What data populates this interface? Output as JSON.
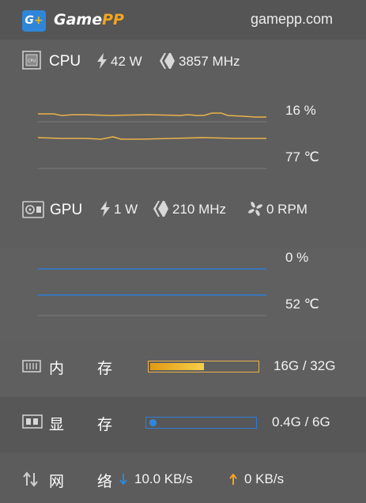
{
  "header": {
    "logo_letter": "G",
    "logo_plus": "+",
    "brand_main": "Game",
    "brand_pp": "PP",
    "site": "gamepp.com"
  },
  "cpu": {
    "label": "CPU",
    "power": "42 W",
    "clock": "3857 MHz",
    "usage": "16 %",
    "temp": "77 ℃",
    "icon_text": "CPU"
  },
  "gpu": {
    "label": "GPU",
    "power": "1 W",
    "clock": "210 MHz",
    "fan": "0 RPM",
    "usage": "0 %",
    "temp": "52 ℃"
  },
  "memory": {
    "label": "内 存",
    "value": "16G / 32G",
    "fill_fraction": 0.5
  },
  "vram": {
    "label": "显 存",
    "value": "0.4G / 6G",
    "fill_fraction": 0.067
  },
  "network": {
    "label": "网 络",
    "download": "10.0 KB/s",
    "upload": "0 KB/s"
  },
  "colors": {
    "accent_orange": "#f3b31f",
    "accent_blue": "#2f86d8",
    "line_orange": "#e9b24a",
    "line_blue": "#2e7cd6"
  },
  "icons": [
    "logo-icon",
    "cpu-chip-icon",
    "bolt-icon",
    "clock-icon",
    "gpu-card-icon",
    "fan-icon",
    "memory-icon",
    "vram-icon",
    "network-arrows-icon",
    "download-arrow-icon",
    "upload-arrow-icon"
  ]
}
